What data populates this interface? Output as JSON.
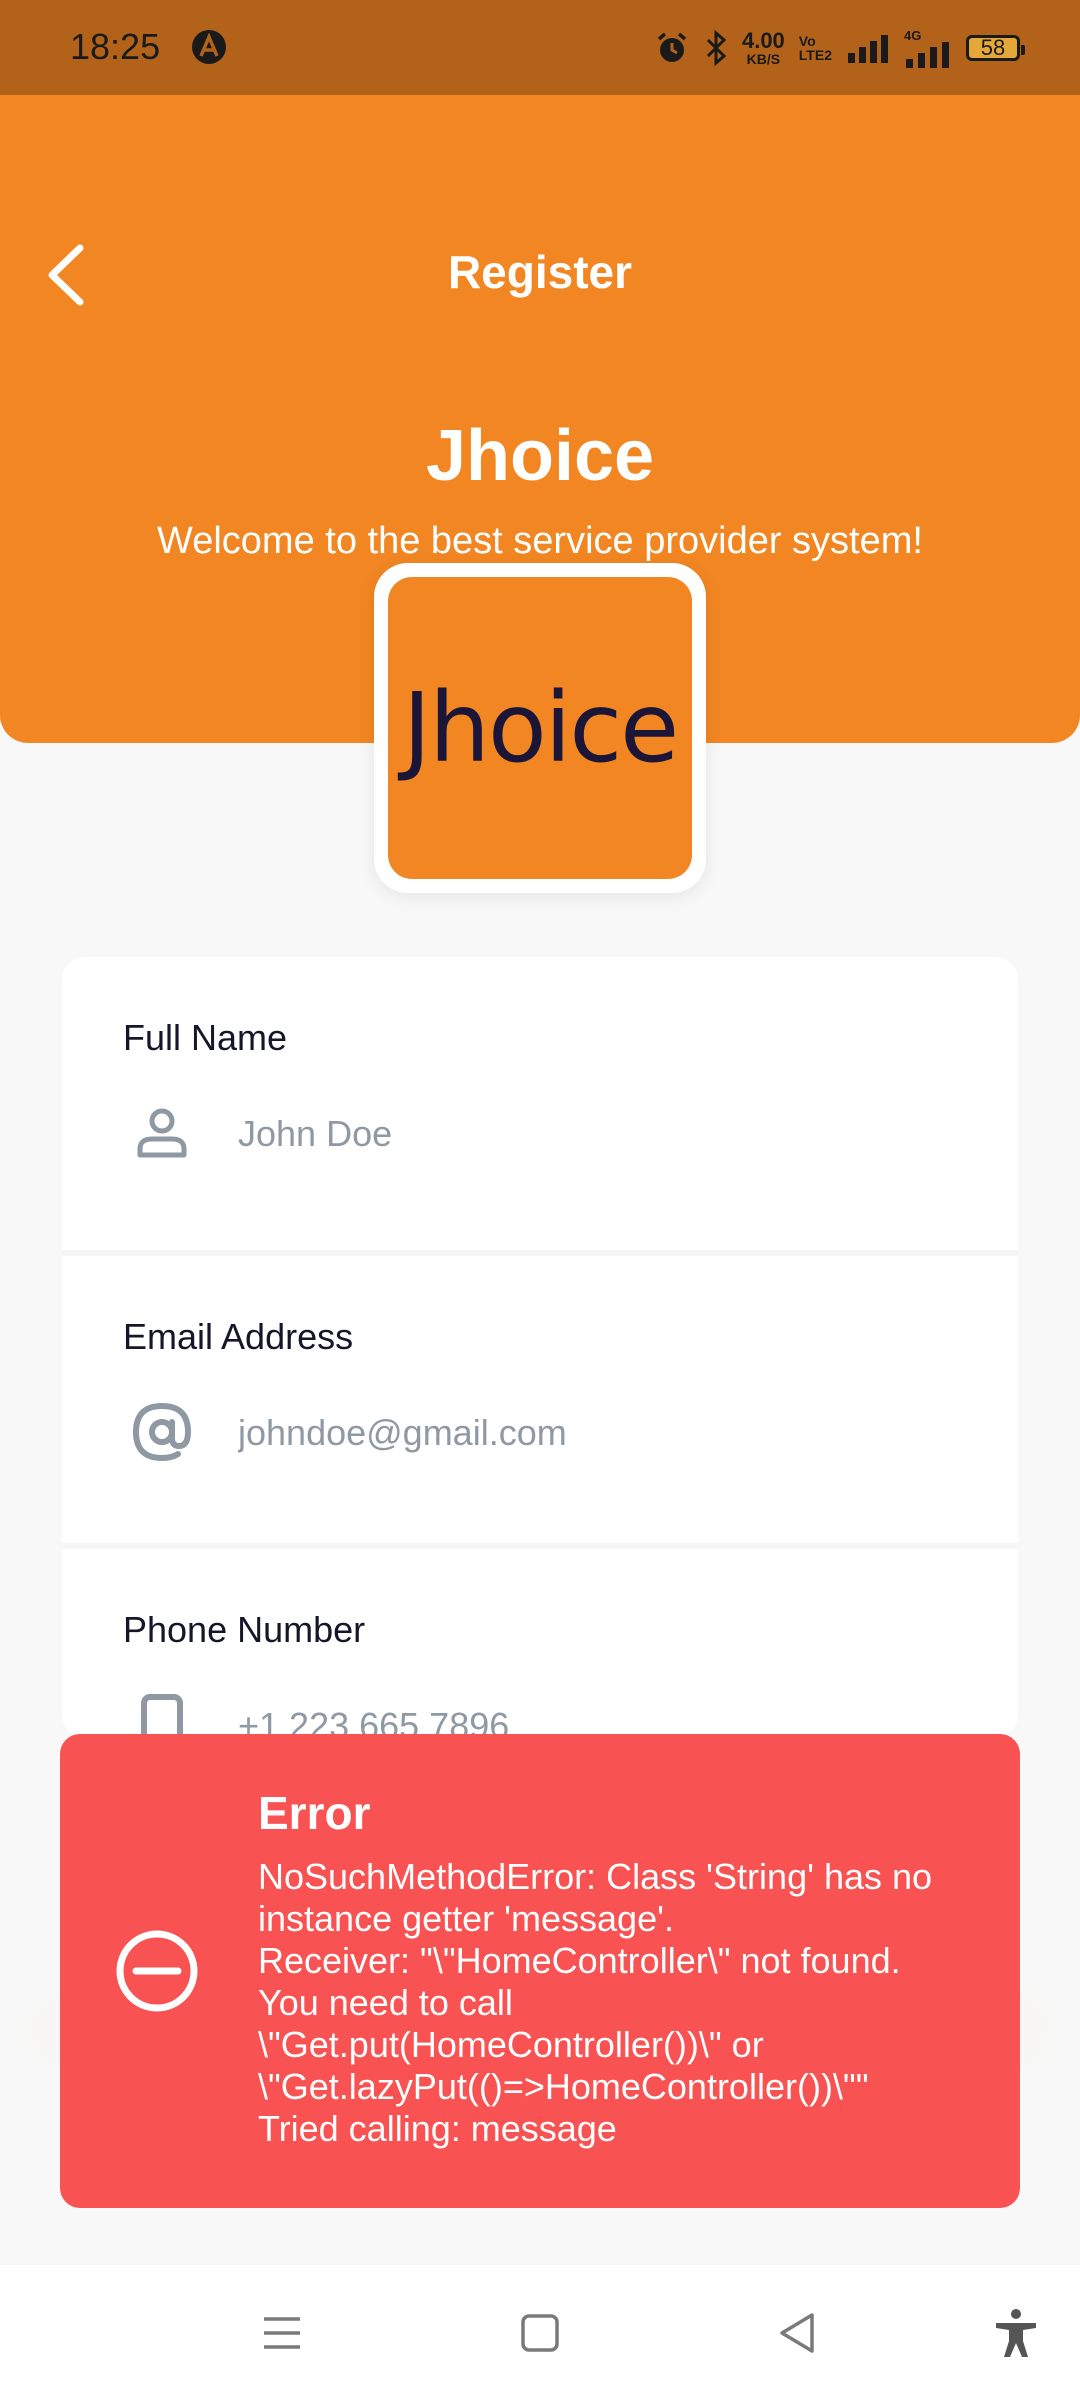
{
  "status_bar": {
    "time": "18:25",
    "net_speed_value": "4.00",
    "net_speed_unit": "KB/S",
    "volte_top": "Vo",
    "volte_bottom": "LTE2",
    "network_label": "4G",
    "battery": "58",
    "icons": [
      "app-a-icon",
      "alarm-icon",
      "bluetooth-icon",
      "signal-icon",
      "signal-4g-icon",
      "battery-icon"
    ]
  },
  "header": {
    "title": "Register",
    "app_name": "Jhoice",
    "tagline": "Welcome to the best service provider system!",
    "logo_text": "Jhoice"
  },
  "form": {
    "full_name": {
      "label": "Full Name",
      "placeholder": "John Doe",
      "icon": "person-icon"
    },
    "email": {
      "label": "Email Address",
      "placeholder": "johndoe@gmail.com",
      "icon": "at-icon"
    },
    "phone": {
      "label": "Phone Number",
      "placeholder": "+1 223 665 7896",
      "icon": "phone-icon"
    }
  },
  "error_toast": {
    "title": "Error",
    "message": "NoSuchMethodError: Class 'String' has no instance getter 'message'.\nReceiver: \"\\\"HomeController\\\" not found. You need to call \\\"Get.put(HomeController())\\\" or \\\"Get.lazyPut(()=>HomeController())\\\"\"\nTried calling: message",
    "icon": "error-minus-circle-icon"
  },
  "nav_bar": {
    "icons": [
      "menu-icon",
      "home-square-icon",
      "back-triangle-icon",
      "accessibility-icon"
    ]
  },
  "colors": {
    "accent": "#f28622",
    "status_bar": "#b3621a",
    "error": "#f85252",
    "logo_text": "#1b1538"
  }
}
